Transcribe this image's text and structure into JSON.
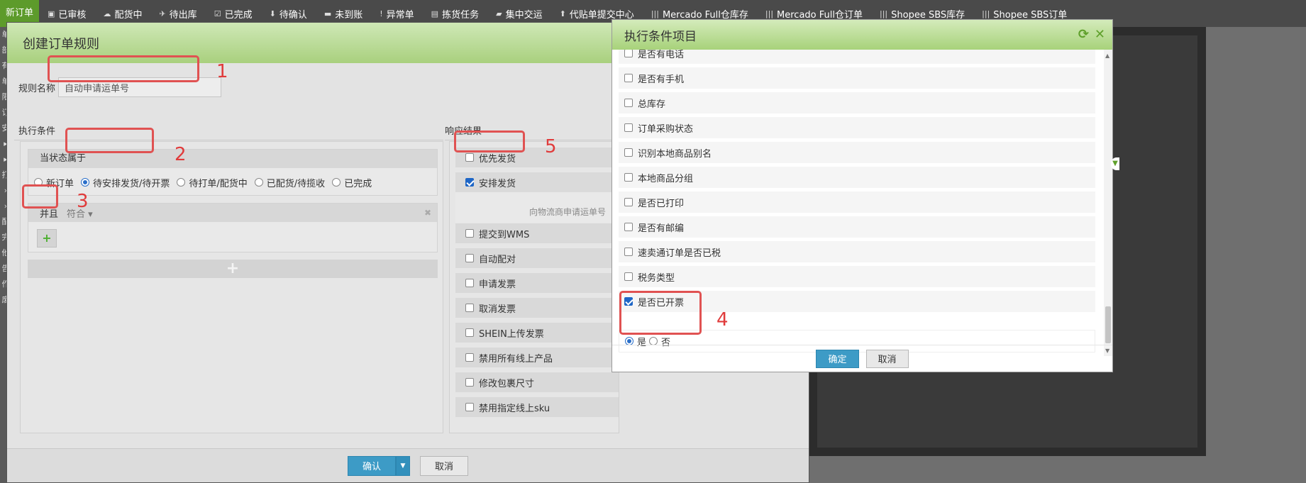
{
  "topnav": {
    "first": "新订单",
    "items": [
      {
        "icon": "gift-icon",
        "glyph": "▣",
        "label": "已审核"
      },
      {
        "icon": "cloud-upload-icon",
        "glyph": "☁",
        "label": "配货中"
      },
      {
        "icon": "plane-icon",
        "glyph": "✈",
        "label": "待出库"
      },
      {
        "icon": "check-square-icon",
        "glyph": "☑",
        "label": "已完成"
      },
      {
        "icon": "pin-icon",
        "glyph": "⬇",
        "label": "待确认"
      },
      {
        "icon": "card-icon",
        "glyph": "▬",
        "label": "未到账"
      },
      {
        "icon": "alert-icon",
        "glyph": "!",
        "label": "异常单"
      },
      {
        "icon": "list-icon",
        "glyph": "▤",
        "label": "拣货任务"
      },
      {
        "icon": "truck-icon",
        "glyph": "▰",
        "label": "集中交运"
      },
      {
        "icon": "upload-icon",
        "glyph": "⬆",
        "label": "代贴单提交中心"
      },
      {
        "icon": "barcode-icon",
        "glyph": "|||",
        "label": "Mercado Full仓库存"
      },
      {
        "icon": "barcode-icon",
        "glyph": "|||",
        "label": "Mercado Full仓订单"
      },
      {
        "icon": "barcode-icon",
        "glyph": "|||",
        "label": "Shopee SBS库存"
      },
      {
        "icon": "barcode-icon",
        "glyph": "|||",
        "label": "Shopee SBS订单"
      }
    ]
  },
  "left_strip": [
    "单",
    "部",
    "有",
    "单",
    "限",
    "订",
    "安",
    "▸",
    "▸",
    "打",
    "›",
    "›",
    "配",
    "完",
    "他",
    "告",
    "作废"
  ],
  "dialog": {
    "title": "创建订单规则",
    "rule_name_label": "规则名称",
    "rule_name_value": "自动申请运单号",
    "cond_title": "执行条件",
    "resp_title": "响应结果",
    "state_header": "当状态属于",
    "states": [
      {
        "label": "新订单",
        "checked": false
      },
      {
        "label": "待安排发货/待开票",
        "checked": true
      },
      {
        "label": "待打单/配货中",
        "checked": false
      },
      {
        "label": "已配货/待揽收",
        "checked": false
      },
      {
        "label": "已完成",
        "checked": false
      }
    ],
    "and_label": "并且",
    "match_label": "符合 ▾",
    "responses": [
      {
        "label": "优先发货",
        "checked": false
      },
      {
        "label": "安排发货",
        "checked": true
      },
      {
        "label": "提交到WMS",
        "checked": false
      },
      {
        "label": "自动配对",
        "checked": false
      },
      {
        "label": "申请发票",
        "checked": false
      },
      {
        "label": "取消发票",
        "checked": false
      },
      {
        "label": "SHEIN上传发票",
        "checked": false
      },
      {
        "label": "禁用所有线上产品",
        "checked": false
      },
      {
        "label": "修改包裹尺寸",
        "checked": false
      },
      {
        "label": "禁用指定线上sku",
        "checked": false
      }
    ],
    "response_hint": "向物流商申请运单号",
    "confirm": "确认",
    "cancel": "取消"
  },
  "picker": {
    "title": "执行条件项目",
    "items": [
      {
        "label": "是否有电话",
        "checked": false
      },
      {
        "label": "是否有手机",
        "checked": false
      },
      {
        "label": "总库存",
        "checked": false
      },
      {
        "label": "订单采购状态",
        "checked": false
      },
      {
        "label": "识别本地商品别名",
        "checked": false
      },
      {
        "label": "本地商品分组",
        "checked": false
      },
      {
        "label": "是否已打印",
        "checked": false
      },
      {
        "label": "是否有邮编",
        "checked": false
      },
      {
        "label": "速卖通订单是否已税",
        "checked": false
      },
      {
        "label": "税务类型",
        "checked": false
      },
      {
        "label": "是否已开票",
        "checked": true
      }
    ],
    "sub_yes": "是",
    "sub_no": "否",
    "ok": "确定",
    "cancel": "取消"
  },
  "annotations": [
    "1",
    "2",
    "3",
    "4",
    "5"
  ]
}
